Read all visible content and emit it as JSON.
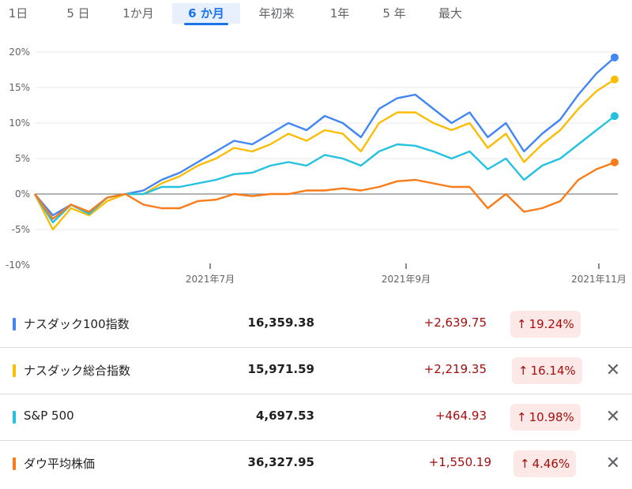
{
  "tabs": [
    {
      "label": "1日",
      "active": false
    },
    {
      "label": "5 日",
      "active": false
    },
    {
      "label": "1か月",
      "active": false
    },
    {
      "label": "6 か月",
      "active": true
    },
    {
      "label": "年初来",
      "active": false
    },
    {
      "label": "1年",
      "active": false
    },
    {
      "label": "5 年",
      "active": false
    },
    {
      "label": "最大",
      "active": false
    }
  ],
  "chart_data": {
    "type": "line",
    "y_ticks": [
      "20%",
      "15%",
      "10%",
      "5%",
      "0%",
      "-5%",
      "-10%"
    ],
    "ylim": [
      -10,
      20
    ],
    "x_ticks": [
      "2021年7月",
      "2021年9月",
      "2021年11月"
    ],
    "grid": true,
    "series": [
      {
        "name": "ナスダック100指数",
        "color": "#4285f4",
        "values": [
          0,
          -3,
          -1.5,
          -2.5,
          -0.5,
          0,
          0.5,
          2,
          3,
          4.5,
          6,
          7.5,
          7,
          8.5,
          10,
          9,
          11,
          10,
          8,
          12,
          13.5,
          14,
          12,
          10,
          11.5,
          8,
          10,
          6,
          8.5,
          10.5,
          14,
          17,
          19.24
        ]
      },
      {
        "name": "ナスダック総合指数",
        "color": "#fbbc04",
        "values": [
          0,
          -5,
          -2,
          -3,
          -1,
          0,
          0,
          1.5,
          2.5,
          4,
          5,
          6.5,
          6,
          7,
          8.5,
          7.5,
          9,
          8.5,
          6,
          10,
          11.5,
          11.5,
          10,
          9,
          10,
          6.5,
          8.5,
          4.5,
          7,
          9,
          12,
          14.5,
          16.14
        ]
      },
      {
        "name": "S&P 500",
        "color": "#24c1e0",
        "values": [
          0,
          -4,
          -1.5,
          -2.8,
          -0.5,
          0,
          0,
          1,
          1,
          1.5,
          2,
          2.8,
          3,
          4,
          4.5,
          4,
          5.5,
          5,
          4,
          6,
          7,
          6.8,
          6,
          5,
          6,
          3.5,
          5,
          2,
          4,
          5,
          7,
          9,
          10.98
        ]
      },
      {
        "name": "ダウ平均株価",
        "color": "#fa7b17",
        "values": [
          0,
          -3.5,
          -1.5,
          -2.5,
          -0.5,
          0,
          -1.5,
          -2,
          -2,
          -1,
          -0.8,
          0,
          -0.3,
          0,
          0,
          0.5,
          0.5,
          0.8,
          0.5,
          1,
          1.8,
          2,
          1.5,
          1,
          1,
          -2,
          0,
          -2.5,
          -2,
          -1,
          2,
          3.5,
          4.46
        ]
      }
    ]
  },
  "rows": [
    {
      "color": "#4285f4",
      "name": "ナスダック100指数",
      "price": "16,359.38",
      "change": "+2,639.75",
      "arrow": "↑",
      "pct": "19.24%",
      "removable": false
    },
    {
      "color": "#fbbc04",
      "name": "ナスダック総合指数",
      "price": "15,971.59",
      "change": "+2,219.35",
      "arrow": "↑",
      "pct": "16.14%",
      "removable": true
    },
    {
      "color": "#24c1e0",
      "name": "S&P 500",
      "price": "4,697.53",
      "change": "+464.93",
      "arrow": "↑",
      "pct": "10.98%",
      "removable": true
    },
    {
      "color": "#fa7b17",
      "name": "ダウ平均株価",
      "price": "36,327.95",
      "change": "+1,550.19",
      "arrow": "↑",
      "pct": "4.46%",
      "removable": true
    }
  ],
  "close_glyph": "✕"
}
